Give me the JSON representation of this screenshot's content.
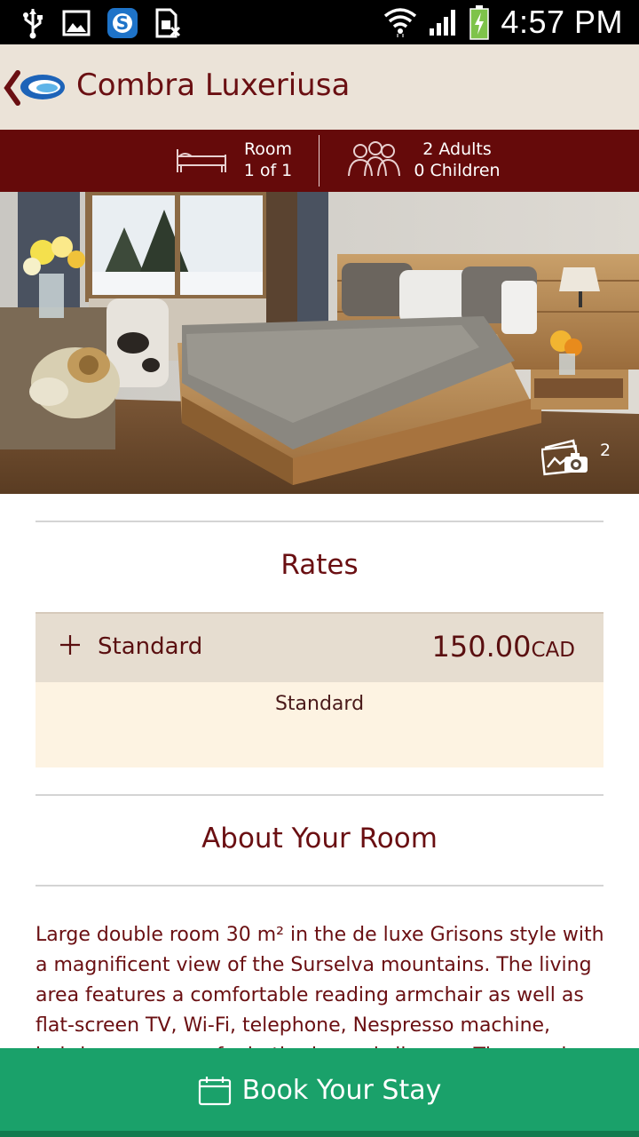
{
  "status_bar": {
    "time": "4:57 PM",
    "icons": [
      "usb-icon",
      "gallery-icon",
      "skype-icon",
      "sim-error-icon",
      "wifi-icon",
      "signal-icon",
      "battery-charging-icon"
    ]
  },
  "app_bar": {
    "title": "Combra Luxeriusa"
  },
  "booking_summary": {
    "room_label": "Room",
    "room_count": "1 of 1",
    "adults": "2 Adults",
    "children": "0 Children"
  },
  "hero": {
    "photo_count": "2"
  },
  "rates": {
    "title": "Rates",
    "items": [
      {
        "name": "Standard",
        "amount": "150.00",
        "currency": "CAD",
        "detail": "Standard"
      }
    ]
  },
  "about": {
    "title": "About Your Room",
    "description": "Large double room 30 m² in the de luxe Grisons style with a magnificent view of the Surselva mountains. The living area features a comfortable reading armchair as well as flat-screen TV, Wi-Fi, telephone, Nespresso machine, hairdryer, room safe, bathrobe and slippers. The spacious, beautiful"
  },
  "cta": {
    "label": "Book Your Stay"
  },
  "colors": {
    "brand_maroon": "#650a0a",
    "text_maroon": "#6a0f12",
    "appbar_beige": "#ebe3d8",
    "cta_green": "#1aa16a"
  }
}
